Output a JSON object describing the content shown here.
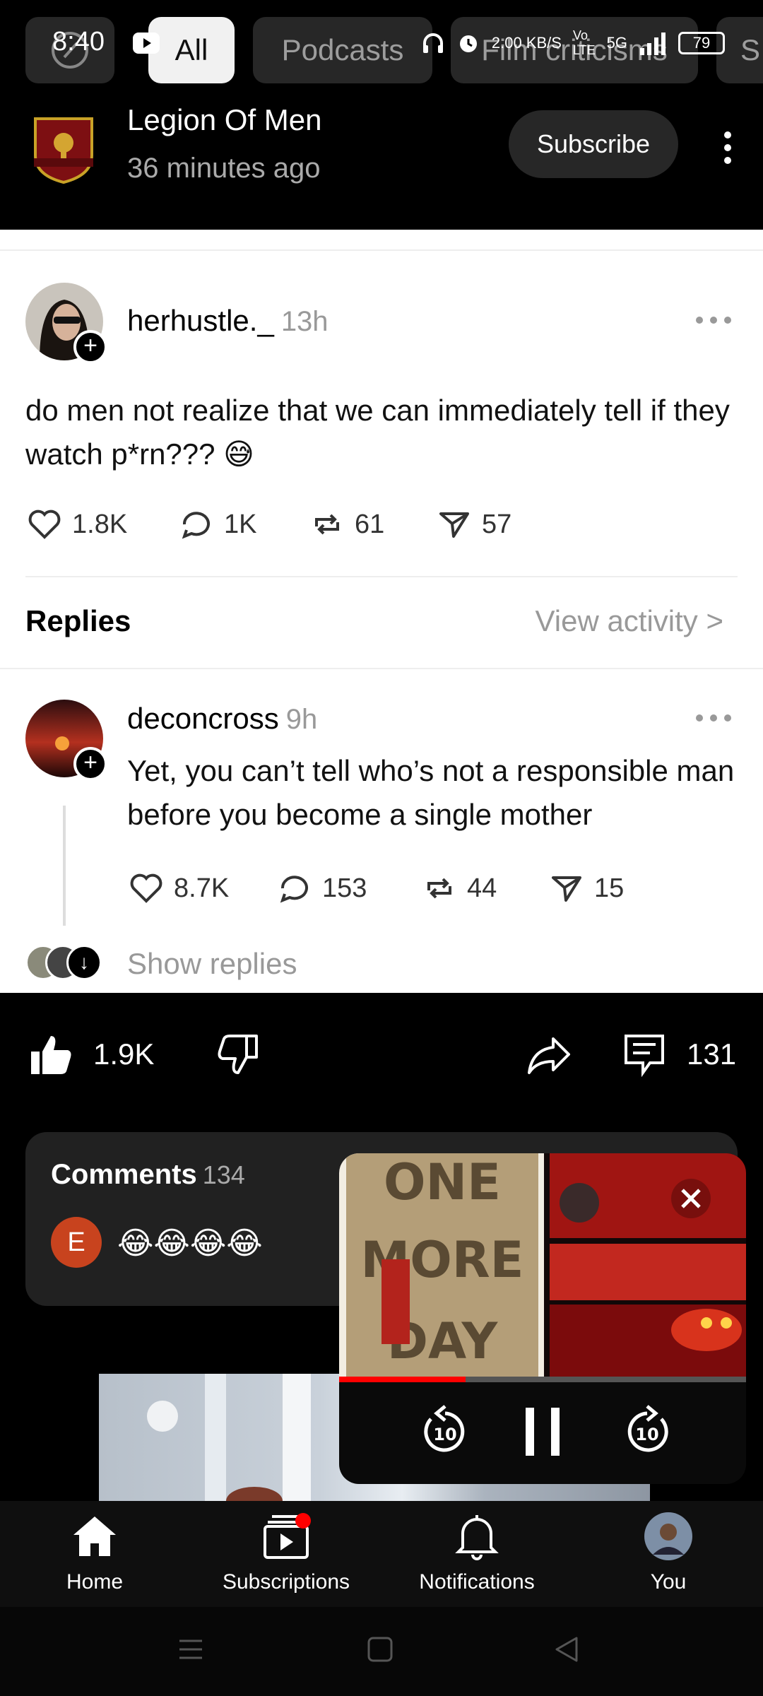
{
  "status_bar": {
    "time": "8:40",
    "net_speed": "2.00 KB/S",
    "network": "5G",
    "battery": "79"
  },
  "chips": [
    {
      "label": "All",
      "active": true
    },
    {
      "label": "Podcasts",
      "active": false
    },
    {
      "label": "Film criticisms",
      "active": false
    },
    {
      "label": "S",
      "active": false
    }
  ],
  "channel": {
    "name": "Legion Of Men",
    "time_ago": "36 minutes ago",
    "subscribe_label": "Subscribe"
  },
  "post": {
    "author": "herhustle._",
    "time": "13h",
    "text": "do men not realize that we can immediately tell if they watch p*rn??? 😅",
    "likes": "1.8K",
    "comments": "1K",
    "reposts": "61",
    "shares": "57",
    "replies_label": "Replies",
    "view_activity": "View activity >",
    "reply": {
      "author": "deconcross",
      "time": "9h",
      "text": "Yet, you can’t tell who’s not a responsible man before you become a single mother",
      "likes": "8.7K",
      "comments": "153",
      "reposts": "44",
      "shares": "15"
    },
    "show_replies": "Show replies"
  },
  "actions": {
    "likes": "1.9K",
    "comment_count": "131"
  },
  "comments_card": {
    "title": "Comments",
    "count": "134",
    "avatar_letter": "E",
    "top_comment": "😂😂😂😂"
  },
  "mini_player": {
    "progress_pct": 31,
    "art_text": "ONE MORE DAY"
  },
  "bottom_nav": [
    {
      "label": "Home",
      "icon": "home-icon"
    },
    {
      "label": "Subscriptions",
      "icon": "subscriptions-icon"
    },
    {
      "label": "Notifications",
      "icon": "bell-icon"
    },
    {
      "label": "You",
      "icon": "avatar"
    }
  ],
  "colors": {
    "accent_red": "#ff0000",
    "card_bg": "#212121",
    "chip_bg": "#272727"
  }
}
